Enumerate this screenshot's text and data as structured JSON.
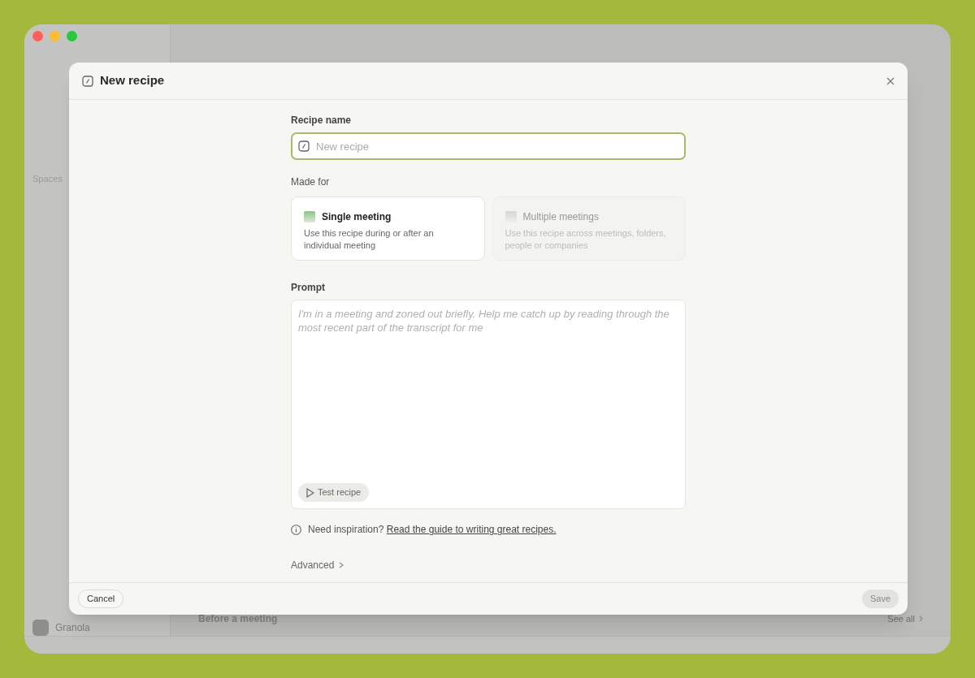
{
  "background": {
    "sidebar": {
      "section_label": "Spaces",
      "workspace": "Granola"
    },
    "main": {
      "section_title": "Before a meeting",
      "link": "See all"
    }
  },
  "dialog": {
    "title": "New recipe",
    "recipe_name": {
      "label": "Recipe name",
      "placeholder": "New recipe"
    },
    "made_for": {
      "label": "Made for",
      "options": [
        {
          "title": "Single meeting",
          "description": "Use this recipe during or after an individual meeting",
          "selected": true
        },
        {
          "title": "Multiple meetings",
          "description": "Use this recipe across meetings, folders, people or companies",
          "selected": false
        }
      ]
    },
    "prompt": {
      "label": "Prompt",
      "placeholder": "I'm in a meeting and zoned out briefly. Help me catch up by reading through the most recent part of the transcript for me",
      "test_button": "Test recipe"
    },
    "hint": {
      "text": "Need inspiration?",
      "link": "Read the guide to writing great recipes."
    },
    "advanced": {
      "label": "Advanced",
      "expanded": false
    },
    "buttons": [
      {
        "kind": "cancel",
        "label": "Cancel",
        "disabled": false
      },
      {
        "kind": "save",
        "label": "Save",
        "disabled": true
      }
    ]
  }
}
